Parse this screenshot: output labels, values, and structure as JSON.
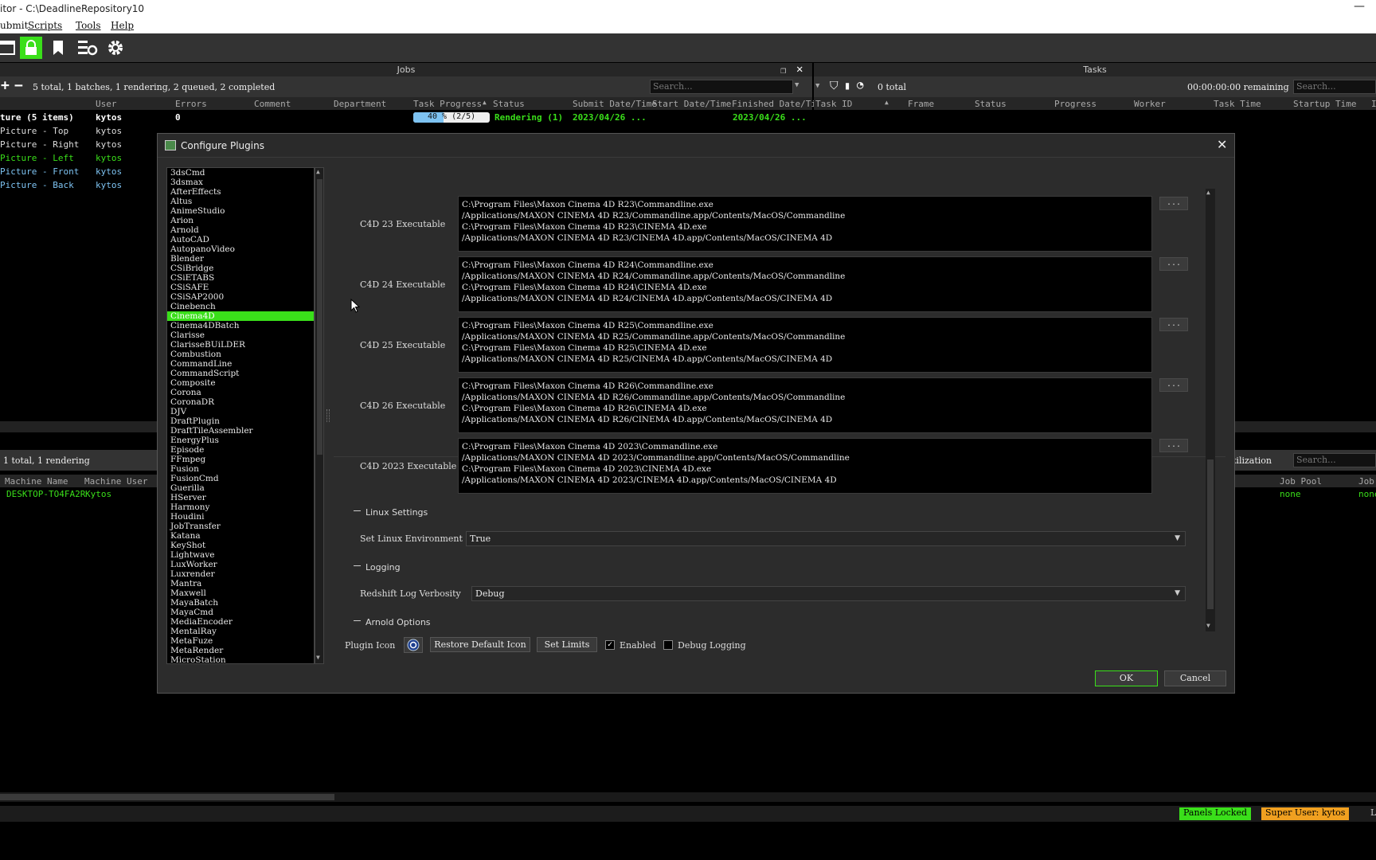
{
  "window": {
    "title": "itor  -  C:\\DeadlineRepository10",
    "minimize": "—"
  },
  "menu": [
    "ubmit",
    "Scripts",
    "Tools",
    "Help"
  ],
  "icons": {
    "toolbar": [
      "window-icon",
      "lock-icon",
      "bookmark-icon",
      "settings-list-icon",
      "gear-icon"
    ]
  },
  "jobs_panel": {
    "title": "Jobs",
    "summary": "5 total, 1 batches, 1 rendering, 2 queued, 2 completed",
    "search_placeholder": "Search...",
    "columns": [
      "User",
      "Errors",
      "Comment",
      "Department",
      "Task Progress",
      "Status",
      "Submit Date/Time",
      "Start Date/Time",
      "Finished Date/Ti"
    ],
    "rows": [
      {
        "name": "ture (5 items)",
        "user": "kytos",
        "errors": "0",
        "progress": "40 % (2/5)",
        "progress_value": 0.4,
        "status": "Rendering (1)",
        "submit": "2023/04/26 ...",
        "finished": "2023/04/26 ..."
      },
      {
        "name": "Picture - Top",
        "user": "kytos"
      },
      {
        "name": "Picture - Right",
        "user": "kytos"
      },
      {
        "name": "Picture - Left",
        "user": "kytos"
      },
      {
        "name": "Picture - Front",
        "user": "kytos"
      },
      {
        "name": "Picture - Back",
        "user": "kytos"
      }
    ]
  },
  "tasks_panel": {
    "title": "Tasks",
    "summary": "0 total",
    "remaining": "00:00:00:00 remaining",
    "search_placeholder": "Search...",
    "columns": [
      "Task ID",
      "Frame",
      "Status",
      "Progress",
      "Worker",
      "Task Time",
      "Startup Time",
      "I"
    ]
  },
  "workers_panel": {
    "summary": "1 total, 1 rendering",
    "columns": [
      "Machine Name",
      "Machine User"
    ],
    "row": {
      "machine": "DESKTOP-TO4FA2R",
      "user": "Kytos",
      "pool": "none",
      "pool2": "none"
    },
    "right_label": "tilization",
    "right_columns": [
      "Job Pool",
      "Job"
    ],
    "search_placeholder": "Search..."
  },
  "status_bar": {
    "panels_locked": "Panels Locked",
    "super_user": "Super User: kytos",
    "trailing": "L",
    "colors": {
      "panels_locked": "#3adf1a",
      "super_user": "#f0a020"
    }
  },
  "dialog": {
    "title": "Configure Plugins",
    "close": "✕",
    "plugins": [
      "3dsCmd",
      "3dsmax",
      "AfterEffects",
      "Altus",
      "AnimeStudio",
      "Arion",
      "Arnold",
      "AutoCAD",
      "AutopanoVideo",
      "Blender",
      "CSiBridge",
      "CSiETABS",
      "CSiSAFE",
      "CSiSAP2000",
      "Cinebench",
      "Cinema4D",
      "Cinema4DBatch",
      "Clarisse",
      "ClarisseBUiLDER",
      "Combustion",
      "CommandLine",
      "CommandScript",
      "Composite",
      "Corona",
      "CoronaDR",
      "DJV",
      "DraftPlugin",
      "DraftTileAssembler",
      "EnergyPlus",
      "Episode",
      "FFmpeg",
      "Fusion",
      "FusionCmd",
      "Guerilla",
      "HServer",
      "Harmony",
      "Houdini",
      "JobTransfer",
      "Katana",
      "KeyShot",
      "Lightwave",
      "LuxWorker",
      "Luxrender",
      "Mantra",
      "Maxwell",
      "MayaBatch",
      "MayaCmd",
      "MediaEncoder",
      "MentalRay",
      "MetaFuze",
      "MetaRender",
      "MicroStation"
    ],
    "selected_plugin": "Cinema4D",
    "executables": [
      {
        "label": "C4D 23 Executable",
        "paths": "C:\\Program Files\\Maxon Cinema 4D R23\\Commandline.exe\n/Applications/MAXON CINEMA 4D R23/Commandline.app/Contents/MacOS/Commandline\nC:\\Program Files\\Maxon Cinema 4D R23\\CINEMA 4D.exe\n/Applications/MAXON CINEMA 4D R23/CINEMA 4D.app/Contents/MacOS/CINEMA 4D",
        "browse": "..."
      },
      {
        "label": "C4D 24 Executable",
        "paths": "C:\\Program Files\\Maxon Cinema 4D R24\\Commandline.exe\n/Applications/MAXON CINEMA 4D R24/Commandline.app/Contents/MacOS/Commandline\nC:\\Program Files\\Maxon Cinema 4D R24\\CINEMA 4D.exe\n/Applications/MAXON CINEMA 4D R24/CINEMA 4D.app/Contents/MacOS/CINEMA 4D",
        "browse": "..."
      },
      {
        "label": "C4D 25 Executable",
        "paths": "C:\\Program Files\\Maxon Cinema 4D R25\\Commandline.exe\n/Applications/MAXON CINEMA 4D R25/Commandline.app/Contents/MacOS/Commandline\nC:\\Program Files\\Maxon Cinema 4D R25\\CINEMA 4D.exe\n/Applications/MAXON CINEMA 4D R25/CINEMA 4D.app/Contents/MacOS/CINEMA 4D",
        "browse": "..."
      },
      {
        "label": "C4D 26 Executable",
        "paths": "C:\\Program Files\\Maxon Cinema 4D R26\\Commandline.exe\n/Applications/MAXON CINEMA 4D R26/Commandline.app/Contents/MacOS/Commandline\nC:\\Program Files\\Maxon Cinema 4D R26\\CINEMA 4D.exe\n/Applications/MAXON CINEMA 4D R26/CINEMA 4D.app/Contents/MacOS/CINEMA 4D",
        "browse": "..."
      },
      {
        "label": "C4D 2023 Executable",
        "paths": "C:\\Program Files\\Maxon Cinema 4D 2023\\Commandline.exe\n/Applications/MAXON CINEMA 4D 2023/Commandline.app/Contents/MacOS/Commandline\nC:\\Program Files\\Maxon Cinema 4D 2023\\CINEMA 4D.exe\n/Applications/MAXON CINEMA 4D 2023/CINEMA 4D.app/Contents/MacOS/CINEMA 4D",
        "browse": "..."
      }
    ],
    "linux_section": "Linux Settings",
    "linux_env_label": "Set Linux Environment",
    "linux_env_value": "True",
    "logging_section": "Logging",
    "log_verbosity_label": "Redshift Log Verbosity",
    "log_verbosity_value": "Debug",
    "arnold_section": "Arnold Options",
    "plugin_icon_label": "Plugin Icon",
    "restore_icon": "Restore Default Icon",
    "set_limits": "Set Limits",
    "enabled_label": "Enabled",
    "enabled_checked": "✓",
    "debug_logging_label": "Debug Logging",
    "ok": "OK",
    "cancel": "Cancel"
  }
}
